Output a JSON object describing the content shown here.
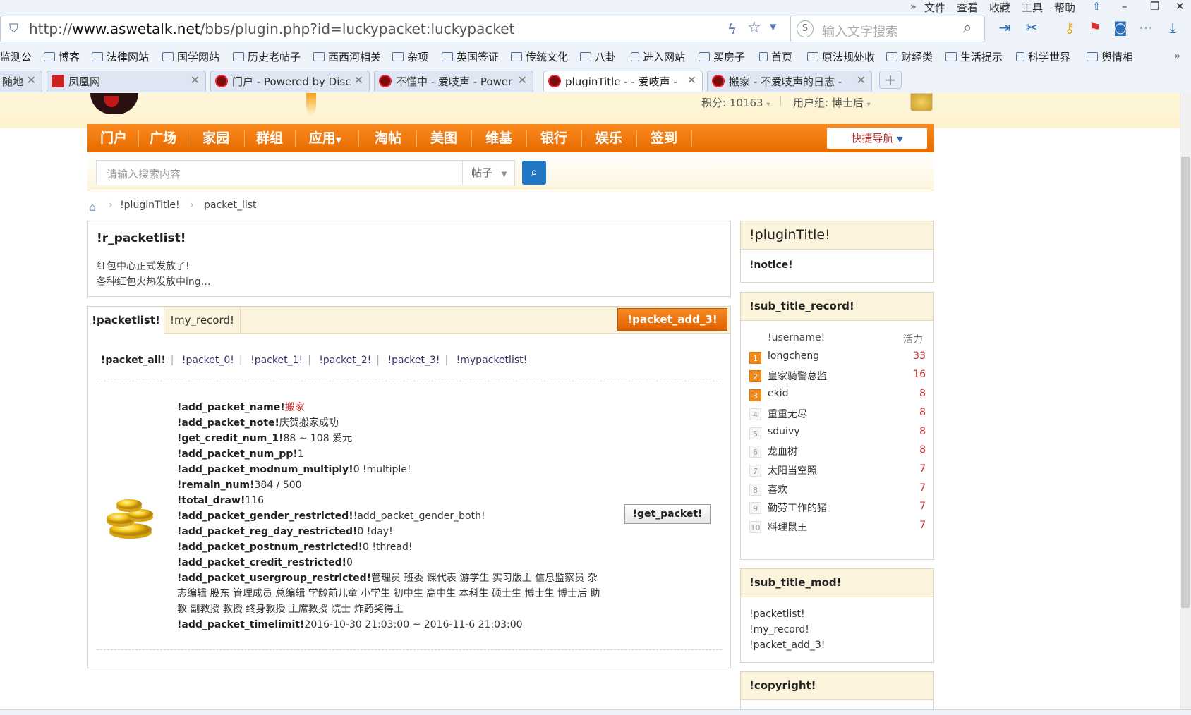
{
  "browser": {
    "menu": [
      "文件",
      "查看",
      "收藏",
      "工具",
      "帮助"
    ],
    "url_prefix": "http://",
    "url_domain": "www.aswetalk.net",
    "url_path": "/bbs/plugin.php?id=luckypacket:luckypacket",
    "search_placeholder": "输入文字搜索",
    "bookmarks": [
      "监测公",
      "博客",
      "法律网站",
      "国学网站",
      "历史老帖子",
      "西西河相关",
      "杂项",
      "英国签证",
      "传统文化",
      "八卦",
      "进入网站",
      "买房子",
      "首页",
      "原法规处收",
      "财经类",
      "生活提示",
      "科学世界",
      "舆情相"
    ],
    "tabs": [
      "随地",
      "凤凰网",
      "门户 - Powered by Disc",
      "不懂中 - 爱吱声 - Power",
      "pluginTitle - - 爱吱声 -",
      "搬家 - 不爱吱声的日志 -"
    ],
    "new_tab": "+"
  },
  "header": {
    "points": "积分: 10163",
    "group": "用户组: 博士后"
  },
  "nav": {
    "items": [
      "门户",
      "广场",
      "家园",
      "群组",
      "应用",
      "淘帖",
      "美图",
      "维基",
      "银行",
      "娱乐",
      "签到"
    ],
    "quick_nav": "快捷导航"
  },
  "site_search": {
    "placeholder": "请输入搜索内容",
    "type": "帖子"
  },
  "breadcrumb": {
    "items": [
      "!pluginTitle!",
      "packet_list"
    ]
  },
  "intro": {
    "title": "!r_packetlist!",
    "line1": "红包中心正式发放了!",
    "line2": "各种红包火热发放中ing…"
  },
  "main": {
    "tab_packetlist": "!packetlist!",
    "tab_my_record": "!my_record!",
    "add_button": "!packet_add_3!",
    "filters": [
      "!packet_all!",
      "!packet_0!",
      "!packet_1!",
      "!packet_2!",
      "!packet_3!",
      "!mypacketlist!"
    ],
    "details": [
      {
        "k": "!add_packet_name!",
        "v": "搬家",
        "red": true
      },
      {
        "k": "!add_packet_note!",
        "v": "庆贺搬家成功"
      },
      {
        "k": "!get_credit_num_1!",
        "v": "88 ~ 108 爱元"
      },
      {
        "k": "!add_packet_num_pp!",
        "v": "1"
      },
      {
        "k": "!add_packet_modnum_multiply!",
        "v": "0 !multiple!"
      },
      {
        "k": "!remain_num!",
        "v": "384 / 500"
      },
      {
        "k": "!total_draw!",
        "v": "116"
      },
      {
        "k": "!add_packet_gender_restricted!",
        "v": "!add_packet_gender_both!"
      },
      {
        "k": "!add_packet_reg_day_restricted!",
        "v": "0 !day!"
      },
      {
        "k": "!add_packet_postnum_restricted!",
        "v": "0 !thread!"
      },
      {
        "k": "!add_packet_credit_restricted!",
        "v": "0"
      },
      {
        "k": "!add_packet_usergroup_restricted!",
        "v": "管理员 班委 课代表 游学生 实习版主 信息监察员 杂志编辑 股东 管理成员 总编辑 学龄前儿童 小学生 初中生 高中生 本科生 硕士生 博士生 博士后 助教 副教授 教授 终身教授 主席教授 院士 炸药奖得主"
      },
      {
        "k": "!add_packet_timelimit!",
        "v": "2016-10-30 21:03:00 ~ 2016-11-6 21:03:00"
      }
    ],
    "get_button": "!get_packet!"
  },
  "sidebar": {
    "title": "!pluginTitle!",
    "notice": "!notice!",
    "record_title": "!sub_title_record!",
    "rank_head_name": "!username!",
    "rank_head_val": "活力",
    "ranking": [
      {
        "n": "1",
        "name": "longcheng",
        "v": "33"
      },
      {
        "n": "2",
        "name": "皇家骑警总监",
        "v": "16"
      },
      {
        "n": "3",
        "name": "ekid",
        "v": "8"
      },
      {
        "n": "4",
        "name": "重重无尽",
        "v": "8"
      },
      {
        "n": "5",
        "name": "sduivy",
        "v": "8"
      },
      {
        "n": "6",
        "name": "龙血树",
        "v": "8"
      },
      {
        "n": "7",
        "name": "太阳当空照",
        "v": "7"
      },
      {
        "n": "8",
        "name": "喜欢",
        "v": "7"
      },
      {
        "n": "9",
        "name": "勤劳工作的猪",
        "v": "7"
      },
      {
        "n": "10",
        "name": "料理鼠王",
        "v": "7"
      }
    ],
    "mod_title": "!sub_title_mod!",
    "mod_items": [
      "!packetlist!",
      "!my_record!",
      "!packet_add_3!"
    ],
    "copyright": "!copyright!"
  },
  "icons": {
    "shield": "shield-icon",
    "search": "search-icon",
    "home": "home-icon",
    "coins": "gold-coins-icon"
  },
  "colors": {
    "nav_orange": "#f07a10",
    "header_bg": "#fdf3d0",
    "rank_red": "#cc3333"
  }
}
